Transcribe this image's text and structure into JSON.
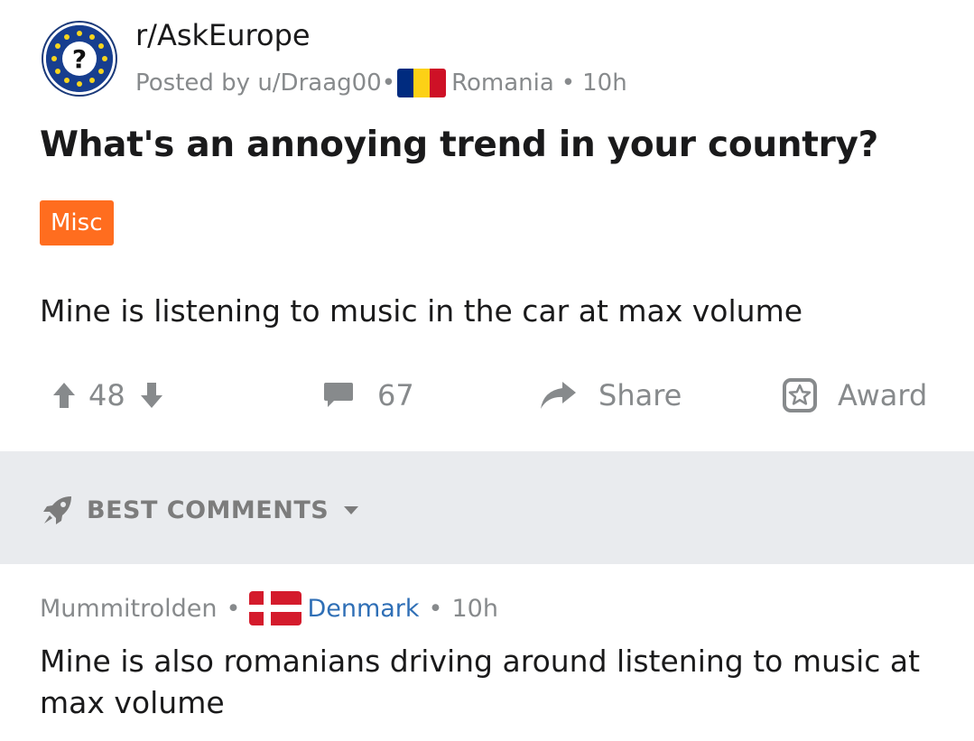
{
  "post": {
    "subreddit": "r/AskEurope",
    "posted_by": "Posted by u/Draag00•",
    "country": "Romania",
    "separator": "•",
    "age": "10h",
    "title": "What's an annoying trend in your country?",
    "flair": "Misc",
    "body": "Mine is listening to music in the car at max volume",
    "votes": "48",
    "comments": "67",
    "share_label": "Share",
    "award_label": "Award"
  },
  "sort": {
    "label": "BEST COMMENTS"
  },
  "comment": {
    "author": "Mummitrolden",
    "separator1": "•",
    "country": "Denmark",
    "separator2": "•",
    "age": "10h",
    "text": "Mine is also romanians driving around listening to music at max volume"
  },
  "colors": {
    "flair": "#ff6d1f",
    "meta_gray": "#878a8c",
    "sort_bar": "#e9ebee",
    "denmark_link": "#2f6fb6"
  },
  "icons": [
    "askeurope-avatar-icon",
    "romania-flag-icon",
    "upvote-icon",
    "downvote-icon",
    "comment-icon",
    "share-icon",
    "award-icon",
    "rocket-icon",
    "chevron-down-icon",
    "denmark-flag-icon"
  ]
}
